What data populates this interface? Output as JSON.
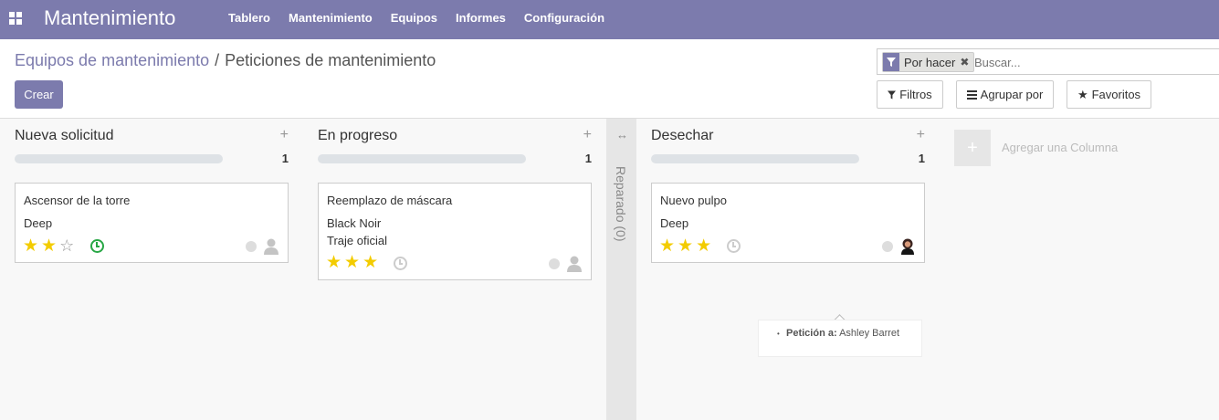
{
  "navbar": {
    "brand": "Mantenimiento",
    "menu": [
      "Tablero",
      "Mantenimiento",
      "Equipos",
      "Informes",
      "Configuración"
    ],
    "bg_color": "#7c7bad"
  },
  "breadcrumb": {
    "parent": "Equipos de mantenimiento",
    "separator": "/",
    "current": "Peticiones de mantenimiento"
  },
  "actions": {
    "create_label": "Crear"
  },
  "search": {
    "facet": "Por hacer",
    "placeholder": "Buscar..."
  },
  "filters": {
    "filtros": "Filtros",
    "agrupar": "Agrupar por",
    "favoritos": "Favoritos"
  },
  "columns": [
    {
      "title": "Nueva solicitud",
      "count": "1",
      "card": {
        "title": "Ascensor de la torre",
        "lines": [
          "Deep"
        ],
        "rating": 2,
        "max_rating": 3,
        "activity_icon": "clock-icon",
        "activity_color": "#28a745"
      }
    },
    {
      "title": "En progreso",
      "count": "1",
      "card": {
        "title": "Reemplazo de máscara",
        "lines": [
          "Black Noir",
          "Traje oficial"
        ],
        "rating": 3,
        "max_rating": 3,
        "activity_icon": "clock-icon"
      }
    },
    {
      "title": "Desechar",
      "count": "1",
      "card": {
        "title": "Nuevo pulpo",
        "lines": [
          "Deep"
        ],
        "rating": 3,
        "max_rating": 3,
        "activity_icon": "clock-icon"
      }
    }
  ],
  "folded_column": {
    "label": "Reparado (0)"
  },
  "add_column": {
    "label": "Agregar una Columna"
  },
  "tooltip": {
    "label": "Petición a:",
    "value": "Ashley Barret"
  }
}
